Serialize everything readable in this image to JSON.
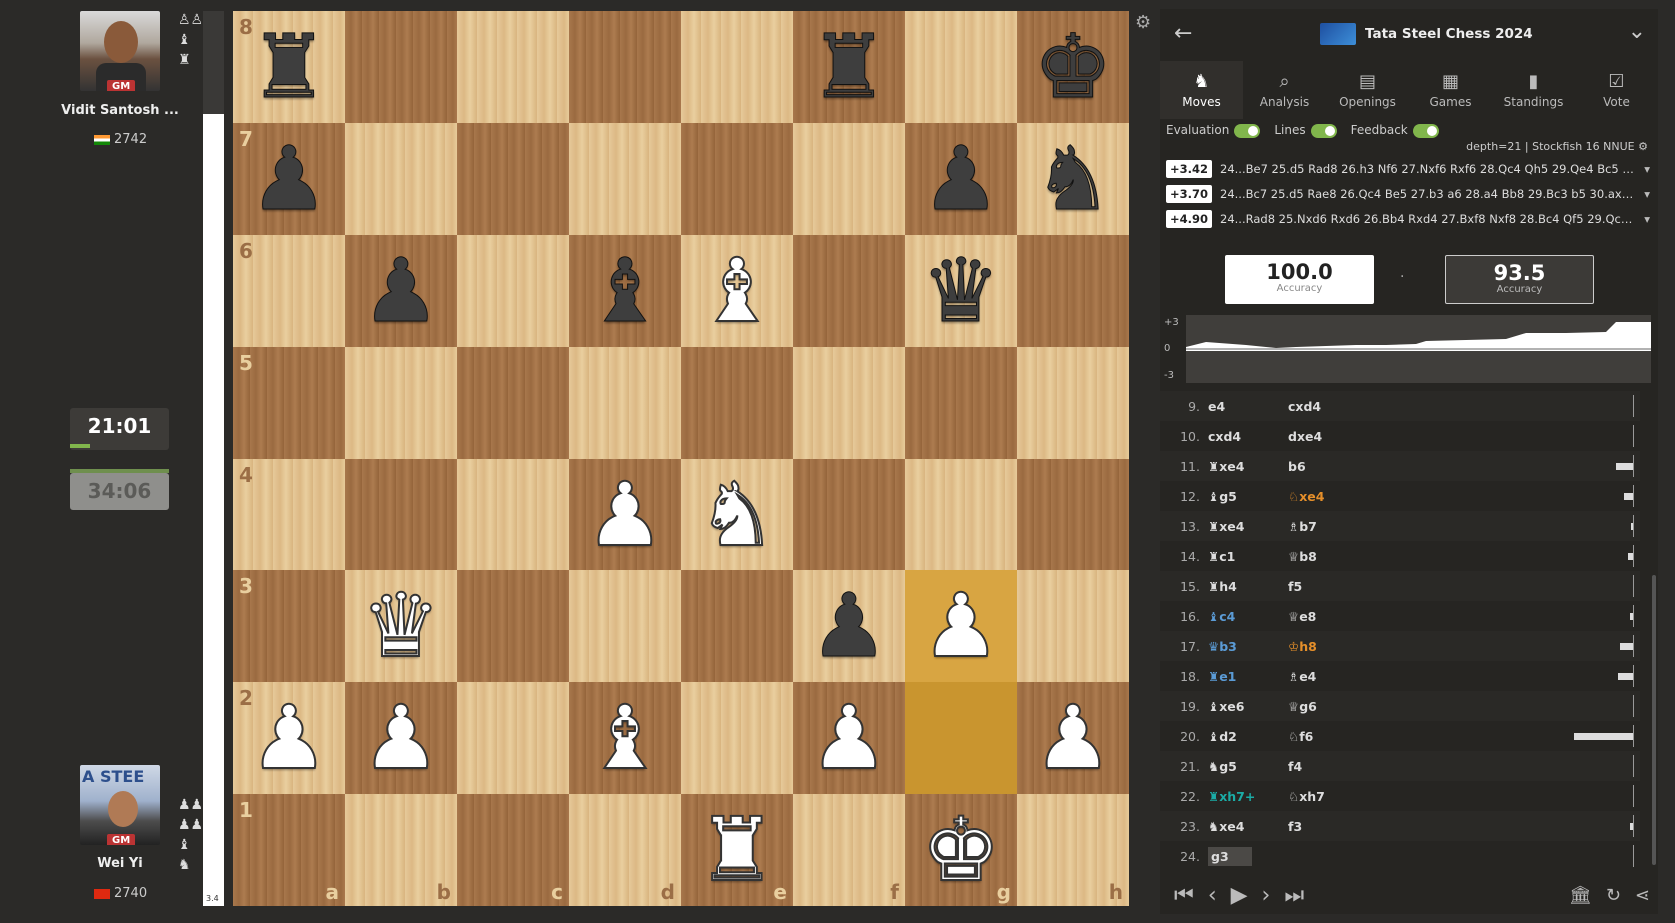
{
  "top_player": {
    "name": "Vidit Santosh ...",
    "rating": "2742",
    "title": "GM",
    "flag_colors": [
      "#ff9933",
      "#ffffff",
      "#138808"
    ],
    "captured": [
      "♙♙",
      "♝",
      "♜"
    ],
    "clock": "21:01"
  },
  "bottom_player": {
    "name": "Wei Yi",
    "rating": "2740",
    "title": "GM",
    "flag_color": "#de2910",
    "captured": [
      "♟♟",
      "♟♟",
      "♝",
      "♞"
    ],
    "clock": "34:06"
  },
  "eval_bar_label": "3.4",
  "board": {
    "ranks": [
      "8",
      "7",
      "6",
      "5",
      "4",
      "3",
      "2",
      "1"
    ],
    "files": [
      "a",
      "b",
      "c",
      "d",
      "e",
      "f",
      "g",
      "h"
    ],
    "rows": [
      [
        "br",
        "",
        "",
        "",
        "",
        "br",
        "",
        "bk"
      ],
      [
        "bp",
        "",
        "",
        "",
        "",
        "",
        "bp",
        "bn"
      ],
      [
        "",
        "bp",
        "",
        "bb",
        "wb",
        "",
        "bq",
        ""
      ],
      [
        "",
        "",
        "",
        "",
        "",
        "",
        "",
        ""
      ],
      [
        "",
        "",
        "",
        "wp",
        "wn",
        "",
        "",
        ""
      ],
      [
        "",
        "wq",
        "",
        "",
        "",
        "bp",
        "wp",
        ""
      ],
      [
        "wp",
        "wp",
        "",
        "wb",
        "",
        "wp",
        "",
        "wp"
      ],
      [
        "",
        "",
        "",
        "",
        "wr",
        "",
        "wk",
        ""
      ]
    ],
    "highlight": [
      [
        5,
        6
      ],
      [
        6,
        6
      ]
    ]
  },
  "header": {
    "title": "Tata Steel Chess 2024",
    "back_icon": "arrow-left-icon",
    "collapse_icon": "chevron-down-icon"
  },
  "tabs": [
    {
      "label": "Moves",
      "icon": "♞",
      "active": true
    },
    {
      "label": "Analysis",
      "icon": "⌕"
    },
    {
      "label": "Openings",
      "icon": "▤"
    },
    {
      "label": "Games",
      "icon": "▦"
    },
    {
      "label": "Standings",
      "icon": "▮"
    },
    {
      "label": "Vote",
      "icon": "☑"
    }
  ],
  "toggles": {
    "evaluation": "Evaluation",
    "lines": "Lines",
    "feedback": "Feedback"
  },
  "engine": {
    "depth": "depth=21 | Stockfish 16 NNUE",
    "lines": [
      {
        "score": "+3.42",
        "moves": "24...Be7 25.d5 Rad8 26.h3 Nf6 27.Nxf6 Rxf6 28.Qc4 Qh5 29.Qe4 Bc5 3..."
      },
      {
        "score": "+3.70",
        "moves": "24...Bc7 25.d5 Rae8 26.Qc4 Be5 27.b3 a6 28.a4 Bb8 29.Bc3 b5 30.axb5 ..."
      },
      {
        "score": "+4.90",
        "moves": "24...Rad8 25.Nxd6 Rxd6 26.Bb4 Rxd4 27.Bxf8 Nxf8 28.Bc4 Qf5 29.Qc3 ..."
      }
    ]
  },
  "accuracy": {
    "white": "100.0",
    "black": "93.5",
    "label": "Accuracy",
    "separator": "·"
  },
  "graph": {
    "labels": [
      "+3",
      "0",
      "-3"
    ]
  },
  "moves": [
    {
      "no": "9.",
      "w": "e4",
      "b": "cxd4",
      "bar": 0
    },
    {
      "no": "10.",
      "w": "cxd4",
      "b": "dxe4",
      "bar": 0
    },
    {
      "no": "11.",
      "w": "♜xe4",
      "b": "b6",
      "bar": 18
    },
    {
      "no": "12.",
      "w": "♝g5",
      "b": "♘xe4",
      "bar": 10,
      "bcolor": "#e58f2a"
    },
    {
      "no": "13.",
      "w": "♜xe4",
      "b": "♗b7",
      "bar": 3
    },
    {
      "no": "14.",
      "w": "♜c1",
      "b": "♕b8",
      "bar": 6
    },
    {
      "no": "15.",
      "w": "♜h4",
      "b": "f5",
      "bar": 0
    },
    {
      "no": "16.",
      "w": "♝c4",
      "b": "♕e8",
      "bar": 4,
      "wcolor": "#5b9bd5"
    },
    {
      "no": "17.",
      "w": "♛b3",
      "b": "♔h8",
      "bar": 14,
      "wcolor": "#5b9bd5",
      "bcolor": "#e58f2a"
    },
    {
      "no": "18.",
      "w": "♜e1",
      "b": "♗e4",
      "bar": 16,
      "wcolor": "#5b9bd5"
    },
    {
      "no": "19.",
      "w": "♝xe6",
      "b": "♕g6",
      "bar": 0
    },
    {
      "no": "20.",
      "w": "♝d2",
      "b": "♘f6",
      "bar": 60
    },
    {
      "no": "21.",
      "w": "♞g5",
      "b": "f4",
      "bar": 0
    },
    {
      "no": "22.",
      "w": "♜xh7+",
      "b": "♘xh7",
      "bar": 0,
      "wcolor": "#1baca6"
    },
    {
      "no": "23.",
      "w": "♞xe4",
      "b": "f3",
      "bar": 4
    },
    {
      "no": "24.",
      "w": "g3",
      "b": "",
      "bar": 0,
      "current": true
    }
  ],
  "controls": [
    "⏮",
    "‹",
    "▶",
    "›",
    "⏭"
  ]
}
